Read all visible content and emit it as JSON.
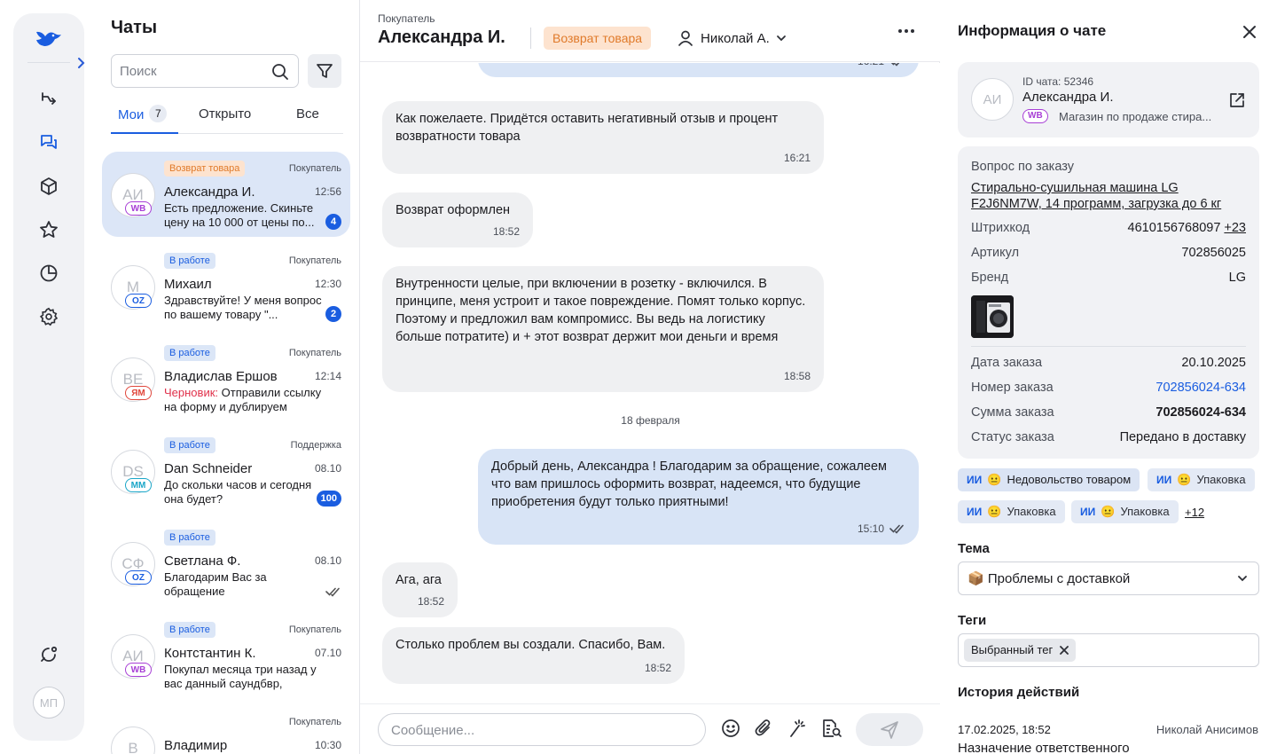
{
  "rail": {
    "avatar": "МП",
    "accent": "#1a5de0"
  },
  "chatlist": {
    "title": "Чаты",
    "search_placeholder": "Поиск",
    "tabs": [
      {
        "label": "Мои",
        "count": "7"
      },
      {
        "label": "Открыто"
      },
      {
        "label": "Все"
      }
    ],
    "items": [
      {
        "initials": "АИ",
        "mp": "WB",
        "mp_color": "#a83fd6",
        "status": "Возврат товара",
        "status_kind": "return",
        "type": "Покупатель",
        "name": "Александра И.",
        "time": "12:56",
        "draft": "",
        "preview": "Есть предложение. Скиньте цену на 10 000 от цены по...",
        "unread": "4"
      },
      {
        "initials": "М",
        "mp": "OZ",
        "mp_color": "#1a5de0",
        "status": "В работе",
        "status_kind": "work",
        "type": "Покупатель",
        "name": "Михаил",
        "time": "12:30",
        "draft": "",
        "preview": "Здравствуйте! У меня вопрос по вашему товару \"...",
        "unread": "2"
      },
      {
        "initials": "ВЕ",
        "mp": "ЯМ",
        "mp_color": "#e0463b",
        "status": "В работе",
        "status_kind": "work",
        "type": "Покупатель",
        "name": "Владислав Ершов",
        "time": "12:14",
        "draft": "Черновик:",
        "preview": "Отправили ссылку на форму и дублируем здесь:...",
        "unread": ""
      },
      {
        "initials": "DS",
        "mp": "ММ",
        "mp_color": "#1aa6c8",
        "status": "В работе",
        "status_kind": "work",
        "type": "Поддержка",
        "name": "Dan Schneider",
        "time": "08.10",
        "draft": "",
        "preview": "До скольки часов и сегодня она будет?",
        "unread": "100"
      },
      {
        "initials": "СФ",
        "mp": "OZ",
        "mp_color": "#1a5de0",
        "status": "В работе",
        "status_kind": "work",
        "type": "",
        "name": "Светлана Ф.",
        "time": "08.10",
        "draft": "",
        "preview": "Благодарим Вас за обращение",
        "unread": ""
      },
      {
        "initials": "АИ",
        "mp": "WB",
        "mp_color": "#a83fd6",
        "status": "В работе",
        "status_kind": "work",
        "type": "Покупатель",
        "name": "Контстантин К.",
        "time": "07.10",
        "draft": "",
        "preview": "Покупал месяца три назад у вас данный саундбвр, появил...",
        "unread": ""
      },
      {
        "initials": "В",
        "mp": "",
        "mp_color": "",
        "status": "",
        "status_kind": "",
        "type": "Покупатель",
        "name": "Владимир",
        "time": "10:30",
        "draft": "",
        "preview": "",
        "unread": ""
      }
    ]
  },
  "header": {
    "label": "Покупатель",
    "name": "Александра И.",
    "status": "Возврат товара",
    "assignee": "Николай А."
  },
  "messages": [
    {
      "dir": "out",
      "text": "",
      "time": "16:21",
      "read": true
    },
    {
      "dir": "in",
      "text": "Как пожелаете. Придётся оставить негативный отзыв и процент возвратности товара",
      "time": "16:21"
    },
    {
      "dir": "in",
      "text": "Возврат оформлен",
      "time": "18:52"
    },
    {
      "dir": "in",
      "text": "Внутренности целые, при включении в розетку - включился. В принципе, меня устроит и такое повреждение. Помят только корпус. Поэтому и предложил вам компромисс. Вы ведь на логистику больше потратите) и + этот возврат держит мои деньги и время",
      "time": "18:58"
    },
    {
      "dir": "out",
      "text": "Добрый день, Александра ! Благодарим за обращение, сожалеем что вам пришлось оформить возврат, надеемся, что будущие приобретения будут только приятными!",
      "time": "15:10",
      "read": true
    },
    {
      "dir": "in",
      "text": "Ага, ага",
      "time": "18:52"
    },
    {
      "dir": "in",
      "text": "Столько проблем вы создали. Спасибо, Вам.",
      "time": "18:52"
    }
  ],
  "date_separator": "18 февраля",
  "composer": {
    "placeholder": "Сообщение..."
  },
  "info": {
    "title": "Информация о чате",
    "card": {
      "initials": "АИ",
      "id": "ID чата: 52346",
      "name": "Александра И.",
      "mp": "WB",
      "shop": "Магазин по продаже стира..."
    },
    "order": {
      "question": "Вопрос по заказу",
      "product": "Стирально-сушильная машина LG F2J6NM7W, 14 программ, загрузка до 6 кг",
      "barcode_label": "Штрихкод",
      "barcode": "4610156768097",
      "barcode_more": "+23",
      "article_label": "Артикул",
      "article": "702856025",
      "brand_label": "Бренд",
      "brand": "LG",
      "date_label": "Дата заказа",
      "date": "20.10.2025",
      "number_label": "Номер заказа",
      "number": "702856024-634",
      "sum_label": "Сумма заказа",
      "sum": "702856024-634",
      "status_label": "Статус заказа",
      "status": "Передано в доставку"
    },
    "ai_tags": [
      {
        "ai": "ИИ",
        "text": "Недовольство товаром"
      },
      {
        "ai": "ИИ",
        "text": "Упаковка"
      },
      {
        "ai": "ИИ",
        "text": "Упаковка"
      },
      {
        "ai": "ИИ",
        "text": "Упаковка"
      }
    ],
    "ai_more": "+12",
    "theme_label": "Тема",
    "theme_value": "📦 Проблемы с доставкой",
    "tags_label": "Теги",
    "tag": "Выбранный тег",
    "history_label": "История действий",
    "history_date": "17.02.2025, 18:52",
    "history_user": "Николай Анисимов",
    "history_text": "Назначение ответственного"
  }
}
